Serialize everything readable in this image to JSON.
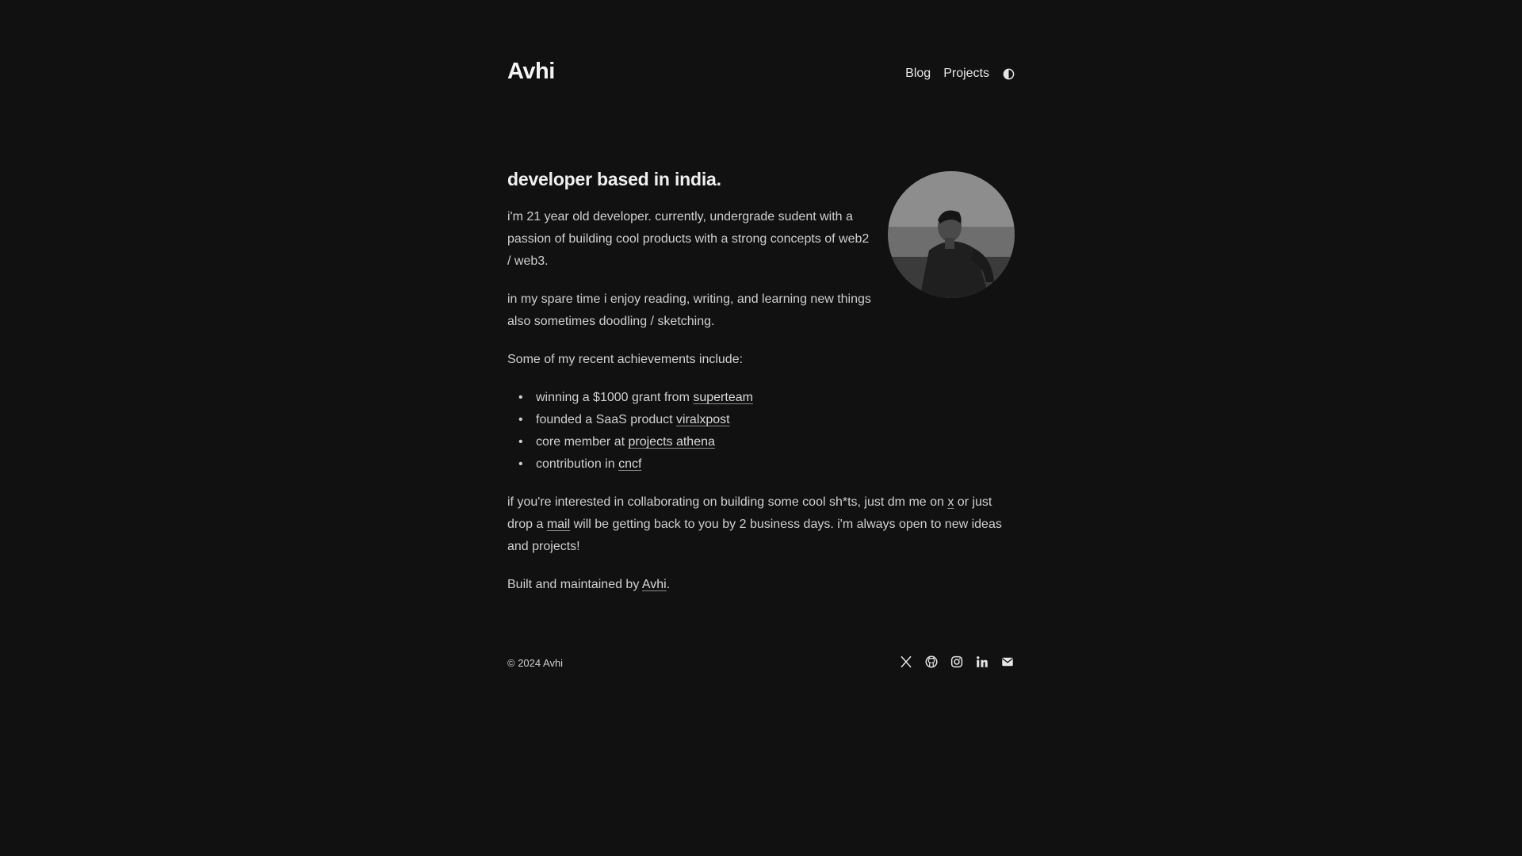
{
  "header": {
    "site_title": "Avhi",
    "nav": [
      {
        "label": "Blog"
      },
      {
        "label": "Projects"
      }
    ],
    "theme_toggle_icon": "contrast-icon"
  },
  "hero": {
    "title": "developer based in india.",
    "avatar_alt": "avatar"
  },
  "intro": {
    "p1": "i'm 21 year old developer. currently, undergrade sudent with a passion of building cool products with a strong concepts of web2 / web3.",
    "p2": "in my spare time i enjoy reading, writing, and learning new things also sometimes doodling / sketching."
  },
  "achievements": {
    "intro": "Some of my recent achievements include:",
    "items": [
      {
        "text": "winning a $1000 grant from ",
        "link": "superteam"
      },
      {
        "text": "founded a SaaS product ",
        "link": "viralxpost"
      },
      {
        "text": "core member at ",
        "link": "projects athena"
      },
      {
        "text": "contribution in ",
        "link": "cncf"
      }
    ]
  },
  "contact": {
    "part1": "if you're interested in collaborating on building some cool sh*ts, just dm me on ",
    "x_link": "x",
    "part2": " or just drop a ",
    "mail_link": "mail",
    "part3": " will be getting back to you by 2 business days. i'm always open to new ideas and projects!"
  },
  "built": {
    "prefix": "Built and maintained by ",
    "link": "Avhi",
    "suffix": "."
  },
  "footer": {
    "copyright": "© 2024 Avhi",
    "social": [
      "x-icon",
      "github-icon",
      "instagram-icon",
      "linkedin-icon",
      "mail-icon"
    ]
  },
  "colors": {
    "background": "#111111",
    "text": "#cfcfcf",
    "heading": "#f0f0f0"
  }
}
